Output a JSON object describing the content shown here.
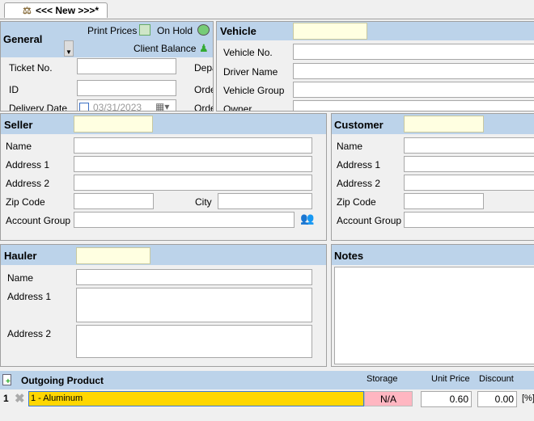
{
  "tab": {
    "label": "<<< New >>>*",
    "icon": "scale-icon"
  },
  "general": {
    "title": "General",
    "print_prices": "Print Prices",
    "on_hold": "On Hold",
    "client_balance": "Client Balance",
    "ticket_no": "Ticket No.",
    "ticket_no_value": "",
    "id": "ID",
    "id_value": "",
    "delivery_date": "Delivery Date",
    "delivery_date_value": "03/31/2023",
    "depa": "Depa",
    "orde1": "Orde",
    "orde2": "Orde"
  },
  "vehicle": {
    "title": "Vehicle",
    "fields": [
      "Vehicle No.",
      "Driver Name",
      "Vehicle Group",
      "Owner"
    ]
  },
  "seller": {
    "title": "Seller",
    "name": "Name",
    "address1": "Address 1",
    "address2": "Address 2",
    "zip": "Zip Code",
    "city": "City",
    "account_group": "Account Group"
  },
  "customer": {
    "title": "Customer",
    "name": "Name",
    "address1": "Address 1",
    "address2": "Address 2",
    "zip": "Zip Code",
    "account_group": "Account Group"
  },
  "hauler": {
    "title": "Hauler",
    "name": "Name",
    "address1": "Address 1",
    "address2": "Address 2"
  },
  "notes": {
    "title": "Notes",
    "value": ""
  },
  "outgoing": {
    "title": "Outgoing Product",
    "storage_header": "Storage",
    "unit_price_header": "Unit Price",
    "discount_header": "Discount",
    "row": {
      "index": "1",
      "product": "1 - Aluminum",
      "storage": "N/A",
      "unit_price": "0.60",
      "discount": "0.00",
      "unit": "[%]"
    }
  },
  "colors": {
    "header": "#bcd3ea",
    "product_highlight": "#ffd700",
    "storage_na": "#ffb6c1",
    "field_yellow": "#ffffe1"
  }
}
